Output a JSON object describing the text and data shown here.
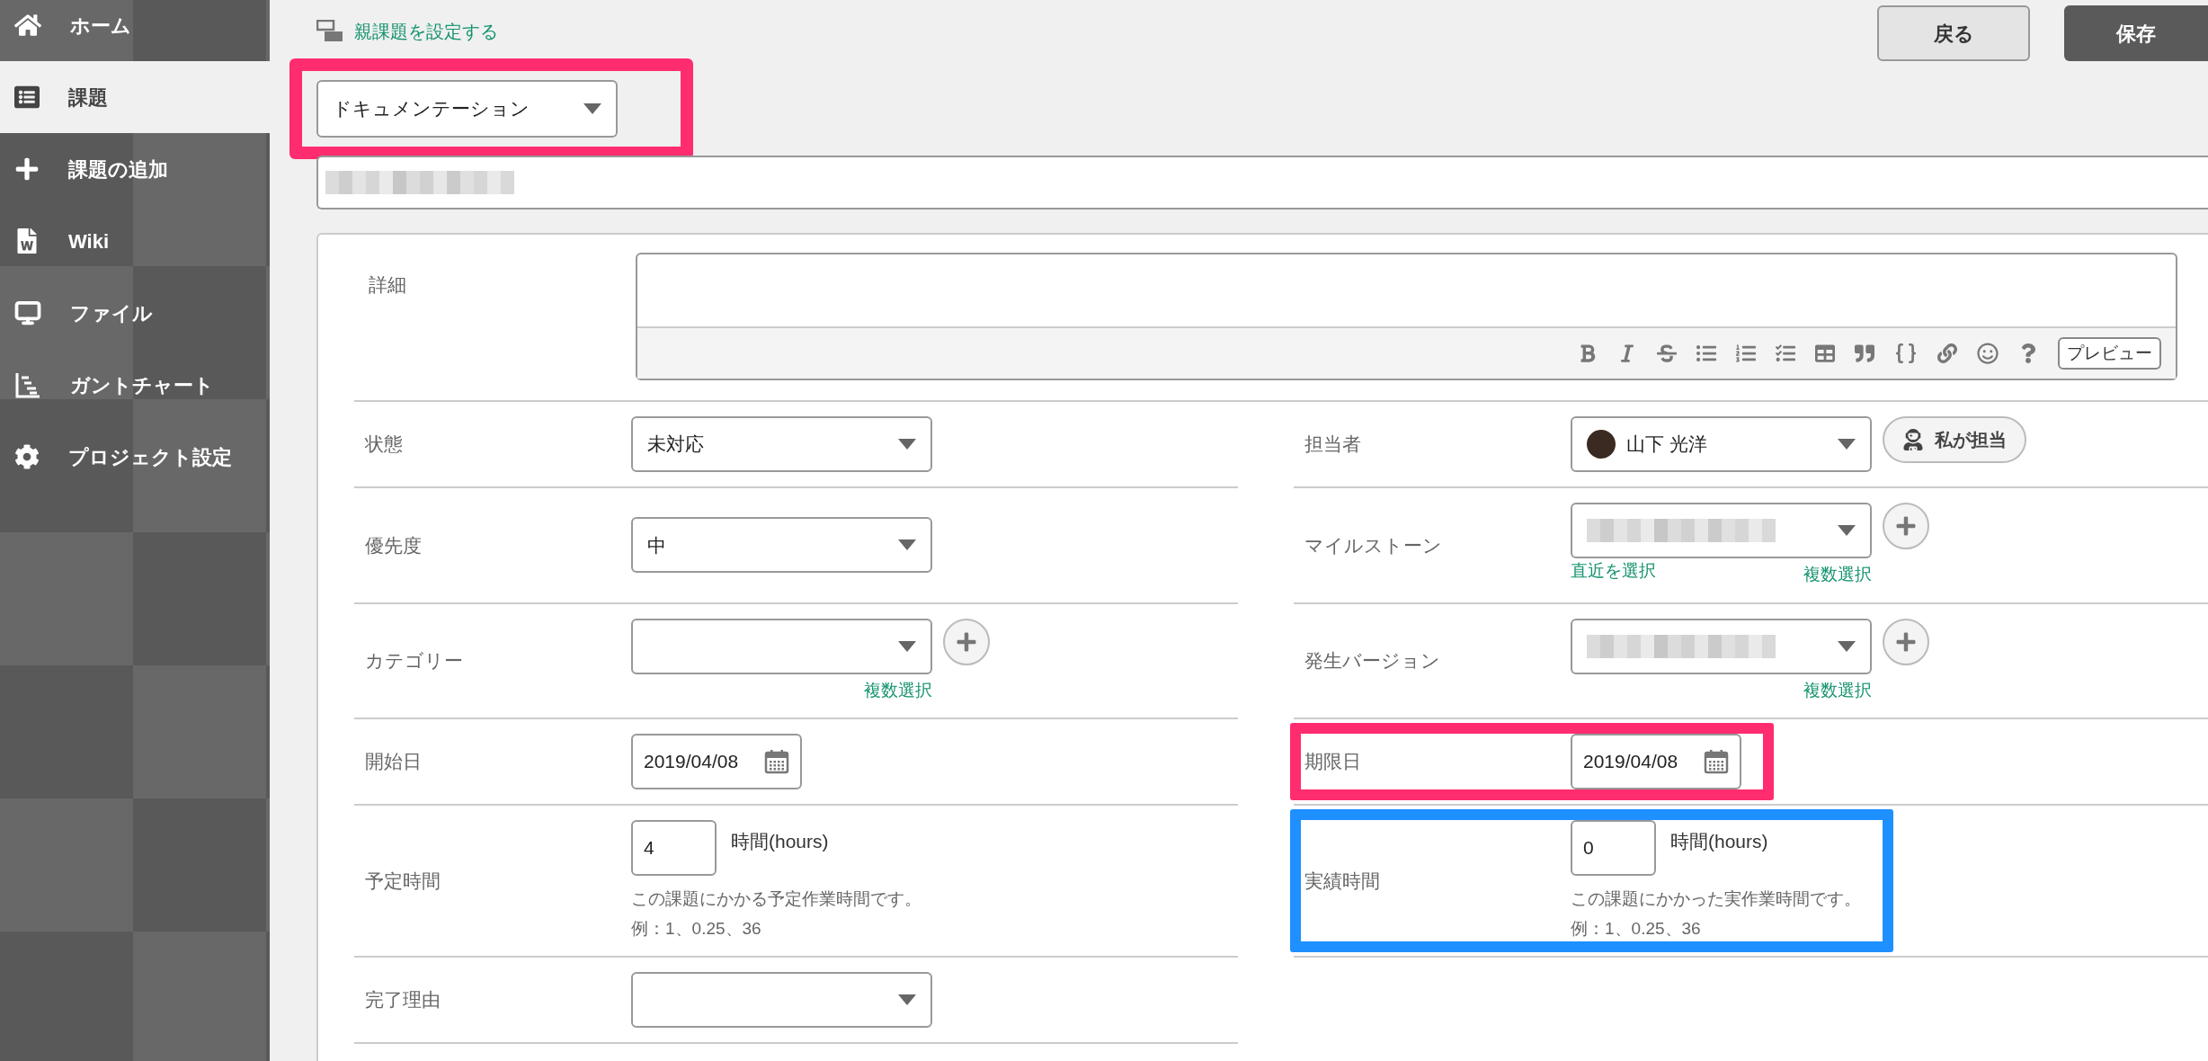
{
  "sidebar": {
    "items": [
      {
        "label": "ホーム",
        "selected": false
      },
      {
        "label": "課題",
        "selected": true
      },
      {
        "label": "課題の追加",
        "selected": false
      },
      {
        "label": "Wiki",
        "selected": false
      },
      {
        "label": "ファイル",
        "selected": false
      },
      {
        "label": "ガントチャート",
        "selected": false
      },
      {
        "label": "プロジェクト設定",
        "selected": false
      }
    ]
  },
  "header": {
    "parent_link": "親課題を設定する",
    "buttons": [
      {
        "label": "戻る",
        "kind": "secondary"
      },
      {
        "label": "保存",
        "kind": "primary"
      }
    ]
  },
  "issue_type": {
    "value": "ドキュメンテーション",
    "color": "#ff2d6f"
  },
  "summary": {
    "blurred": true
  },
  "details": {
    "label": "詳細",
    "preview_button": "プレビュー"
  },
  "form": {
    "left": [
      {
        "label": "状態",
        "kind": "select",
        "value": "未対応"
      },
      {
        "label": "優先度",
        "kind": "select",
        "value": "中"
      },
      {
        "label": "カテゴリー",
        "kind": "select",
        "add_button": true,
        "links": [
          {
            "text": "複数選択"
          }
        ]
      },
      {
        "label": "開始日",
        "kind": "date",
        "value": "2019/04/08"
      },
      {
        "label": "予定時間",
        "kind": "hours",
        "value": "4",
        "unit": "時間(hours)",
        "help": "この課題にかかる予定作業時間です。",
        "example": "例：1、0.25、36"
      },
      {
        "label": "完了理由",
        "kind": "select"
      }
    ],
    "right": [
      {
        "label": "担当者",
        "kind": "select",
        "avatar": true,
        "value": "山下 光洋",
        "side_button": "私が担当"
      },
      {
        "label": "マイルストーン",
        "kind": "select",
        "blurred": true,
        "add_button": true,
        "links": [
          {
            "text": "直近を選択"
          },
          {
            "text": "複数選択"
          }
        ]
      },
      {
        "label": "発生バージョン",
        "kind": "select",
        "blurred": true,
        "add_button": true,
        "links": [
          {
            "text": "複数選択"
          }
        ]
      },
      {
        "label": "期限日",
        "kind": "date",
        "value": "2019/04/08",
        "color": "#ff2d6f"
      },
      {
        "label": "実績時間",
        "kind": "hours",
        "value": "0",
        "unit": "時間(hours)",
        "help": "この課題にかかった実作業時間です。",
        "example": "例：1、0.25、36",
        "color": "#1e90ff"
      }
    ]
  }
}
